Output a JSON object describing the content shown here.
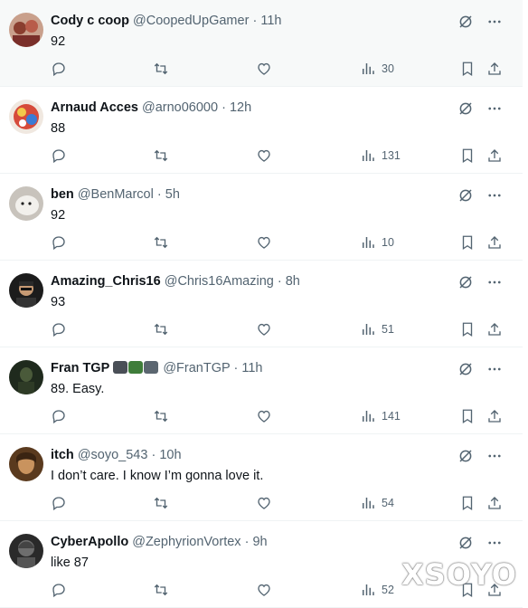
{
  "tweets": [
    {
      "name": "Cody c coop",
      "handle": "@CoopedUpGamer",
      "time": "11h",
      "text": "92",
      "views": "30",
      "avatar_color": "#b86a5a"
    },
    {
      "name": "Arnaud Acces",
      "handle": "@arno06000",
      "time": "12h",
      "text": "88",
      "views": "131",
      "avatar_color": "#c43a3a"
    },
    {
      "name": "ben",
      "handle": "@BenMarcol",
      "time": "5h",
      "text": "92",
      "views": "10",
      "avatar_color": "#d8d6d2"
    },
    {
      "name": "Amazing_Chris16",
      "handle": "@Chris16Amazing",
      "time": "8h",
      "text": "93",
      "views": "51",
      "avatar_color": "#1a1a1a"
    },
    {
      "name": "Fran TGP",
      "handle": "@FranTGP",
      "time": "11h",
      "text": "89. Easy.",
      "views": "141",
      "avatar_color": "#2b3a2a",
      "emojis": [
        "game-controller",
        "clapper-board",
        "camera"
      ]
    },
    {
      "name": "itch",
      "handle": "@soyo_543",
      "time": "10h",
      "text": "I don’t care. I know I’m gonna love it.",
      "views": "54",
      "avatar_color": "#6b4a2a"
    },
    {
      "name": "CyberApollo",
      "handle": "@ZephyrionVortex",
      "time": "9h",
      "text": "like 87",
      "views": "52",
      "avatar_color": "#1e1e1e"
    }
  ],
  "separator": "·",
  "watermark": "XSOYO",
  "colors": {
    "text": "#0f1419",
    "muted": "#536471",
    "border": "#eff3f4",
    "hover_bg": "#f7f9f9"
  }
}
